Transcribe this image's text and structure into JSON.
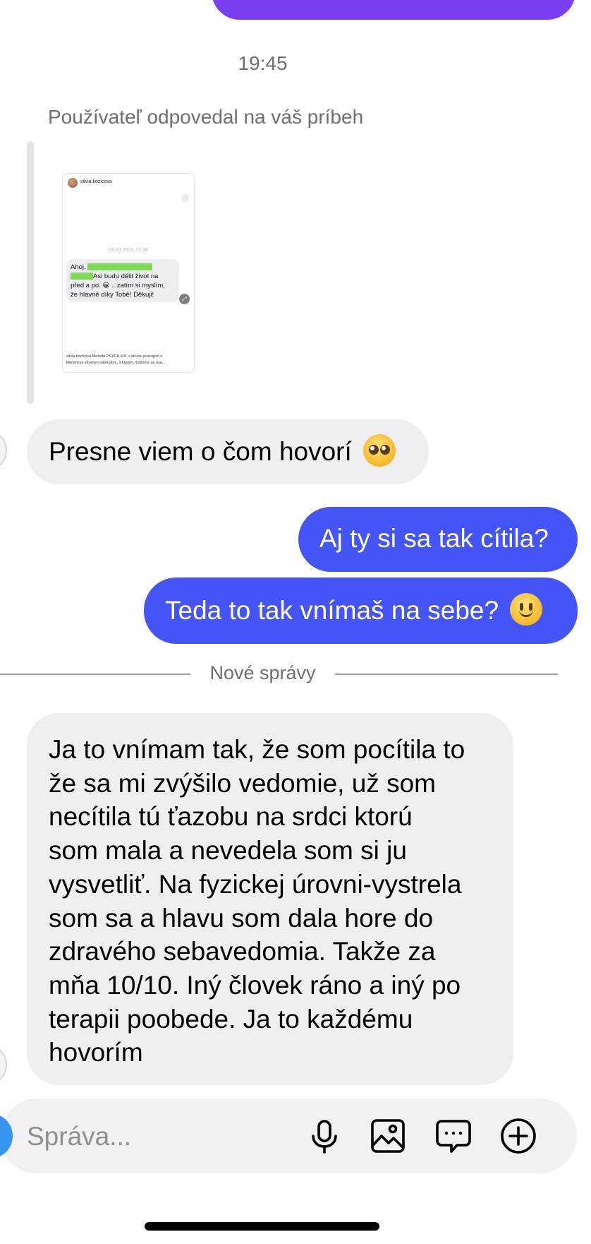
{
  "thread": {
    "timestamp": "19:45",
    "story_reply_note": "Používateľ odpovedal na váš príbeh"
  },
  "story_preview": {
    "username": "silvia.kozicova",
    "date": "08.10.2023, 11:16",
    "message_lines": [
      "Ahoj. ",
      "Asi budu dělit život na",
      "před a po. 😀 ...zatím si myslím,",
      "že hlavně díky Tobě! Děkuji!"
    ],
    "caption_line1": "silvia.kozicova Metóda PSYCH-K®, s ktorou pracujem s",
    "caption_line2": "klientmi je skvelým nástrojom, s ktorým môžeme us uvo..."
  },
  "messages": [
    {
      "id": "m1",
      "direction": "incoming",
      "text": "Presne viem o čom hovorí",
      "emoji": "pleading-face"
    },
    {
      "id": "m2",
      "direction": "outgoing",
      "text": "Aj ty si sa tak cítila?"
    },
    {
      "id": "m3",
      "direction": "outgoing",
      "text": "Teda to tak vnímaš na sebe?",
      "emoji": "slightly-smiling-face"
    }
  ],
  "divider": {
    "label": "Nové správy"
  },
  "long_message": {
    "direction": "incoming",
    "lines": [
      "Ja to vnímam tak, že som pocítila to",
      "že sa mi zvýšilo vedomie, už som",
      "necítila tú ťazobu na srdci ktorú",
      "som mala a nevedela som si ju",
      "vysvetliť. Na fyzickej úrovni-vystrela",
      "som sa a hlavu som dala hore do",
      "zdravého sebavedomia. Takže za",
      "mňa 10/10. Iný človek ráno a iný po",
      "terapii poobede. Ja to každému",
      "hovorím"
    ]
  },
  "composer": {
    "placeholder": "Správa...",
    "icons": [
      "microphone-icon",
      "gallery-icon",
      "sticker-chat-icon",
      "plus-icon"
    ]
  },
  "colors": {
    "outgoing_bubble": "#4454f7",
    "top_bubble": "#7b3ff2",
    "incoming_bubble": "#efeff1",
    "camera_button": "#3796f0"
  }
}
